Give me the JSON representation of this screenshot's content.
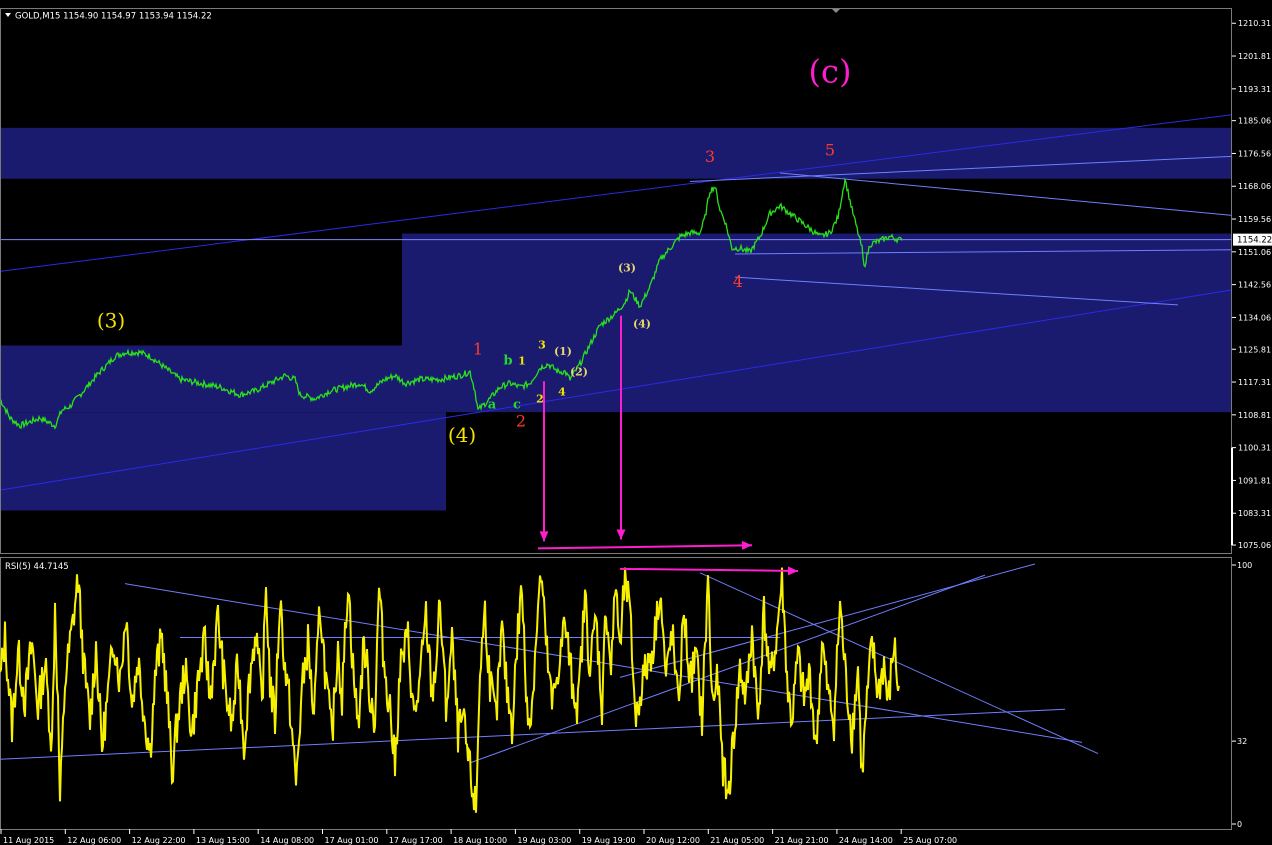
{
  "chart_data": [
    {
      "type": "line",
      "header": "GOLD,M15  1154.90 1154.97 1153.94 1154.22",
      "symbol": "GOLD",
      "timeframe": "M15",
      "ohlc": {
        "open": 1154.9,
        "high": 1154.97,
        "low": 1153.94,
        "close": 1154.22
      },
      "current_price": 1154.22,
      "current_price_label": "1154.22",
      "ylim": [
        1073.0,
        1214.0
      ],
      "y_ticks": [
        "1210.31",
        "1201.81",
        "1193.31",
        "1185.06",
        "1176.56",
        "1168.06",
        "1159.56",
        "1151.06",
        "1142.56",
        "1134.06",
        "1125.81",
        "1117.31",
        "1108.81",
        "1100.31",
        "1091.81",
        "1083.31",
        "1075.06"
      ],
      "x_ticks": [
        "11 Aug 2015",
        "12 Aug 06:00",
        "12 Aug 22:00",
        "13 Aug 15:00",
        "14 Aug 08:00",
        "17 Aug 01:00",
        "17 Aug 17:00",
        "18 Aug 10:00",
        "19 Aug 03:00",
        "19 Aug 19:00",
        "20 Aug 12:00",
        "21 Aug 05:00",
        "21 Aug 21:00",
        "24 Aug 14:00",
        "25 Aug 07:00"
      ],
      "series_keypoints": [
        [
          0,
          1113
        ],
        [
          10,
          1108
        ],
        [
          20,
          1106
        ],
        [
          40,
          1108
        ],
        [
          55,
          1106
        ],
        [
          62,
          1110
        ],
        [
          70,
          1111
        ],
        [
          80,
          1114
        ],
        [
          90,
          1117
        ],
        [
          100,
          1120
        ],
        [
          108,
          1122
        ],
        [
          115,
          1124
        ],
        [
          125,
          1125
        ],
        [
          140,
          1125
        ],
        [
          150,
          1124
        ],
        [
          160,
          1122
        ],
        [
          170,
          1120
        ],
        [
          180,
          1118
        ],
        [
          200,
          1117
        ],
        [
          220,
          1116
        ],
        [
          240,
          1114
        ],
        [
          255,
          1115
        ],
        [
          270,
          1117
        ],
        [
          285,
          1119
        ],
        [
          295,
          1118
        ],
        [
          300,
          1114
        ],
        [
          315,
          1113
        ],
        [
          330,
          1115
        ],
        [
          345,
          1116
        ],
        [
          360,
          1117
        ],
        [
          370,
          1115
        ],
        [
          385,
          1118
        ],
        [
          395,
          1119
        ],
        [
          405,
          1117
        ],
        [
          420,
          1118
        ],
        [
          440,
          1118
        ],
        [
          460,
          1119
        ],
        [
          470,
          1120
        ],
        [
          475,
          1115
        ],
        [
          478,
          1110
        ],
        [
          490,
          1113
        ],
        [
          500,
          1116
        ],
        [
          510,
          1117
        ],
        [
          520,
          1116
        ],
        [
          530,
          1117
        ],
        [
          540,
          1121
        ],
        [
          548,
          1122
        ],
        [
          558,
          1120
        ],
        [
          565,
          1120
        ],
        [
          570,
          1118
        ],
        [
          580,
          1122
        ],
        [
          590,
          1127
        ],
        [
          600,
          1132
        ],
        [
          615,
          1135
        ],
        [
          625,
          1138
        ],
        [
          630,
          1141
        ],
        [
          640,
          1137
        ],
        [
          650,
          1142
        ],
        [
          660,
          1149
        ],
        [
          670,
          1152
        ],
        [
          680,
          1155
        ],
        [
          690,
          1156
        ],
        [
          700,
          1156
        ],
        [
          705,
          1160
        ],
        [
          710,
          1167
        ],
        [
          715,
          1168
        ],
        [
          720,
          1162
        ],
        [
          725,
          1159
        ],
        [
          732,
          1152
        ],
        [
          740,
          1152
        ],
        [
          750,
          1151
        ],
        [
          760,
          1155
        ],
        [
          770,
          1161
        ],
        [
          780,
          1163
        ],
        [
          790,
          1161
        ],
        [
          800,
          1159
        ],
        [
          810,
          1157
        ],
        [
          820,
          1155
        ],
        [
          830,
          1156
        ],
        [
          838,
          1160
        ],
        [
          845,
          1170
        ],
        [
          852,
          1162
        ],
        [
          858,
          1156
        ],
        [
          862,
          1152
        ],
        [
          864,
          1147
        ],
        [
          870,
          1153
        ],
        [
          880,
          1154
        ],
        [
          890,
          1155
        ],
        [
          902,
          1154
        ]
      ],
      "zones": [
        {
          "t0": 0,
          "t1": 1232,
          "p0": 1183.2,
          "p1": 1170.0
        },
        {
          "t0": 402,
          "t1": 1232,
          "p0": 1155.8,
          "p1": 1109.5
        },
        {
          "t0": 0,
          "t1": 402,
          "p0": 1126.8,
          "p1": 1109.5
        },
        {
          "t0": 0,
          "t1": 446,
          "p0": 1109.5,
          "p1": 1084.0
        }
      ],
      "trendlines": [
        {
          "t0": 0,
          "p0": 1146.0,
          "t1": 1232,
          "p1": 1186.6,
          "color": "#2a2ae8"
        },
        {
          "t0": 0,
          "p0": 1089.3,
          "t1": 1232,
          "p1": 1141.2,
          "color": "#2a2ae8"
        },
        {
          "t0": 690,
          "p0": 1169.3,
          "t1": 1232,
          "p1": 1175.8,
          "color": "#6f7fff"
        },
        {
          "t0": 780,
          "p0": 1171.5,
          "t1": 1232,
          "p1": 1160.5,
          "color": "#6f7fff"
        },
        {
          "t0": 735,
          "p0": 1150.5,
          "t1": 1232,
          "p1": 1151.6,
          "color": "#6f7fff"
        },
        {
          "t0": 735,
          "p0": 1144.5,
          "t1": 1178,
          "p1": 1137.3,
          "color": "#6f7fff"
        }
      ],
      "wave_labels": [
        {
          "text": "(3)",
          "t": 111,
          "p": 1131.5,
          "color": "#f4e300",
          "size": 20
        },
        {
          "text": "(4)",
          "t": 462,
          "p": 1101.8,
          "color": "#f4e300",
          "size": 20
        },
        {
          "text": "(c)",
          "t": 830,
          "p": 1195.0,
          "color": "#ff1ecf",
          "size": 32
        },
        {
          "text": "1",
          "t": 478,
          "p": 1124.5,
          "color": "#ff3b2a",
          "size": 16
        },
        {
          "text": "2",
          "t": 521,
          "p": 1105.8,
          "color": "#ff3b2a",
          "size": 16
        },
        {
          "text": "3",
          "t": 710,
          "p": 1174.4,
          "color": "#ff3b2a",
          "size": 16
        },
        {
          "text": "4",
          "t": 738,
          "p": 1142.0,
          "color": "#ff3b2a",
          "size": 16
        },
        {
          "text": "5",
          "t": 830,
          "p": 1176.0,
          "color": "#ff3b2a",
          "size": 16
        },
        {
          "text": "a",
          "t": 492,
          "p": 1110.5,
          "color": "#22d830",
          "size": 13
        },
        {
          "text": "b",
          "t": 508,
          "p": 1121.8,
          "color": "#22d830",
          "size": 13
        },
        {
          "text": "c",
          "t": 517,
          "p": 1110.5,
          "color": "#22d830",
          "size": 13
        },
        {
          "text": "1",
          "t": 522,
          "p": 1121.8,
          "color": "#f4e300",
          "size": 11
        },
        {
          "text": "2",
          "t": 540,
          "p": 1112.0,
          "color": "#f4e300",
          "size": 11
        },
        {
          "text": "3",
          "t": 542,
          "p": 1126.0,
          "color": "#f4e300",
          "size": 11
        },
        {
          "text": "4",
          "t": 562,
          "p": 1113.8,
          "color": "#f4e300",
          "size": 11
        },
        {
          "text": "(1)",
          "t": 563,
          "p": 1124.3,
          "color": "#e6d86a",
          "size": 11
        },
        {
          "text": "(2)",
          "t": 579,
          "p": 1119.0,
          "color": "#e6d86a",
          "size": 11
        },
        {
          "text": "(3)",
          "t": 627,
          "p": 1146.0,
          "color": "#e6d86a",
          "size": 11
        },
        {
          "text": "(4)",
          "t": 642,
          "p": 1131.5,
          "color": "#e6d86a",
          "size": 11
        }
      ],
      "arrows": [
        {
          "t0": 544,
          "p0": 1117.5,
          "t1": 544,
          "p1": 1076.0
        },
        {
          "t0": 621,
          "p0": 1134.5,
          "t1": 621,
          "p1": 1076.5
        },
        {
          "t0": 538,
          "p0": 1074.2,
          "t1": 752,
          "p1": 1075.0
        }
      ],
      "colors": {
        "background": "#000000",
        "zone": "#1a1a6e",
        "price_line": "#29e21b",
        "price_marker_line": "#7f86ff",
        "arrow": "#ff1ecf",
        "axis": "#ffffff",
        "tick_text": "#ffffff"
      }
    },
    {
      "type": "line",
      "indicator": "RSI(5) 44.7145",
      "ylim": [
        0,
        100
      ],
      "y_ticks": [
        "100",
        "32",
        "0"
      ],
      "y_tick_values": [
        100,
        32,
        0
      ],
      "series_keypoints": [
        [
          0,
          55
        ],
        [
          5,
          72
        ],
        [
          12,
          38
        ],
        [
          18,
          66
        ],
        [
          25,
          48
        ],
        [
          32,
          70
        ],
        [
          38,
          45
        ],
        [
          45,
          62
        ],
        [
          52,
          30
        ],
        [
          55,
          85
        ],
        [
          58,
          45
        ],
        [
          60,
          8
        ],
        [
          65,
          55
        ],
        [
          72,
          75
        ],
        [
          78,
          95
        ],
        [
          84,
          60
        ],
        [
          90,
          40
        ],
        [
          96,
          68
        ],
        [
          102,
          30
        ],
        [
          108,
          50
        ],
        [
          114,
          72
        ],
        [
          120,
          55
        ],
        [
          126,
          82
        ],
        [
          132,
          46
        ],
        [
          138,
          64
        ],
        [
          145,
          40
        ],
        [
          150,
          28
        ],
        [
          156,
          60
        ],
        [
          162,
          72
        ],
        [
          168,
          45
        ],
        [
          172,
          20
        ],
        [
          178,
          42
        ],
        [
          185,
          60
        ],
        [
          192,
          35
        ],
        [
          198,
          55
        ],
        [
          205,
          70
        ],
        [
          210,
          48
        ],
        [
          218,
          80
        ],
        [
          225,
          52
        ],
        [
          232,
          38
        ],
        [
          238,
          62
        ],
        [
          244,
          30
        ],
        [
          250,
          58
        ],
        [
          256,
          75
        ],
        [
          262,
          45
        ],
        [
          266,
          92
        ],
        [
          270,
          55
        ],
        [
          275,
          40
        ],
        [
          280,
          88
        ],
        [
          285,
          60
        ],
        [
          290,
          45
        ],
        [
          296,
          15
        ],
        [
          302,
          52
        ],
        [
          308,
          70
        ],
        [
          314,
          40
        ],
        [
          320,
          85
        ],
        [
          326,
          55
        ],
        [
          332,
          33
        ],
        [
          338,
          70
        ],
        [
          342,
          48
        ],
        [
          348,
          95
        ],
        [
          353,
          60
        ],
        [
          358,
          38
        ],
        [
          364,
          70
        ],
        [
          370,
          50
        ],
        [
          375,
          40
        ],
        [
          379,
          92
        ],
        [
          384,
          62
        ],
        [
          390,
          45
        ],
        [
          395,
          22
        ],
        [
          400,
          60
        ],
        [
          408,
          72
        ],
        [
          414,
          40
        ],
        [
          420,
          55
        ],
        [
          426,
          80
        ],
        [
          432,
          50
        ],
        [
          436,
          62
        ],
        [
          440,
          85
        ],
        [
          446,
          45
        ],
        [
          452,
          70
        ],
        [
          458,
          35
        ],
        [
          463,
          40
        ],
        [
          470,
          20
        ],
        [
          476,
          5
        ],
        [
          480,
          60
        ],
        [
          485,
          82
        ],
        [
          490,
          55
        ],
        [
          496,
          40
        ],
        [
          502,
          75
        ],
        [
          506,
          55
        ],
        [
          512,
          38
        ],
        [
          518,
          75
        ],
        [
          522,
          92
        ],
        [
          526,
          50
        ],
        [
          531,
          40
        ],
        [
          536,
          72
        ],
        [
          541,
          97
        ],
        [
          546,
          70
        ],
        [
          552,
          45
        ],
        [
          558,
          60
        ],
        [
          565,
          78
        ],
        [
          572,
          55
        ],
        [
          578,
          45
        ],
        [
          585,
          88
        ],
        [
          590,
          60
        ],
        [
          596,
          80
        ],
        [
          602,
          45
        ],
        [
          606,
          85
        ],
        [
          611,
          60
        ],
        [
          616,
          94
        ],
        [
          620,
          65
        ],
        [
          625,
          97
        ],
        [
          630,
          80
        ],
        [
          636,
          40
        ],
        [
          642,
          55
        ],
        [
          648,
          62
        ],
        [
          654,
          70
        ],
        [
          660,
          92
        ],
        [
          666,
          55
        ],
        [
          672,
          75
        ],
        [
          678,
          45
        ],
        [
          684,
          82
        ],
        [
          690,
          55
        ],
        [
          696,
          65
        ],
        [
          702,
          40
        ],
        [
          708,
          95
        ],
        [
          712,
          48
        ],
        [
          718,
          55
        ],
        [
          722,
          25
        ],
        [
          728,
          10
        ],
        [
          734,
          35
        ],
        [
          740,
          60
        ],
        [
          746,
          48
        ],
        [
          752,
          75
        ],
        [
          758,
          40
        ],
        [
          764,
          82
        ],
        [
          770,
          55
        ],
        [
          776,
          70
        ],
        [
          782,
          95
        ],
        [
          788,
          50
        ],
        [
          792,
          40
        ],
        [
          798,
          65
        ],
        [
          804,
          48
        ],
        [
          810,
          58
        ],
        [
          816,
          28
        ],
        [
          822,
          70
        ],
        [
          828,
          50
        ],
        [
          834,
          40
        ],
        [
          840,
          85
        ],
        [
          846,
          55
        ],
        [
          852,
          35
        ],
        [
          858,
          60
        ],
        [
          862,
          18
        ],
        [
          866,
          42
        ],
        [
          872,
          70
        ],
        [
          878,
          50
        ],
        [
          884,
          62
        ],
        [
          888,
          45
        ],
        [
          894,
          70
        ],
        [
          900,
          45
        ]
      ],
      "trendlines": [
        {
          "t0": 0,
          "p0": 25.0,
          "t1": 1065,
          "p1": 44.3
        },
        {
          "t0": 125,
          "p0": 92.8,
          "t1": 1082,
          "p1": 31.5
        },
        {
          "t0": 470,
          "p0": 23.6,
          "t1": 985,
          "p1": 96.1
        },
        {
          "t0": 700,
          "p0": 97.0,
          "t1": 1098,
          "p1": 27.2
        },
        {
          "t0": 620,
          "p0": 56.6,
          "t1": 1035,
          "p1": 100.4
        },
        {
          "t0": 180,
          "p0": 72.0,
          "t1": 780,
          "p1": 72.0
        }
      ],
      "arrows": [
        {
          "t0": 620,
          "p0": 98.5,
          "t1": 798,
          "p1": 97.7
        }
      ],
      "colors": {
        "price_line": "#f7f100",
        "trendline": "#6f7fff",
        "arrow": "#ff1ecf"
      }
    }
  ]
}
